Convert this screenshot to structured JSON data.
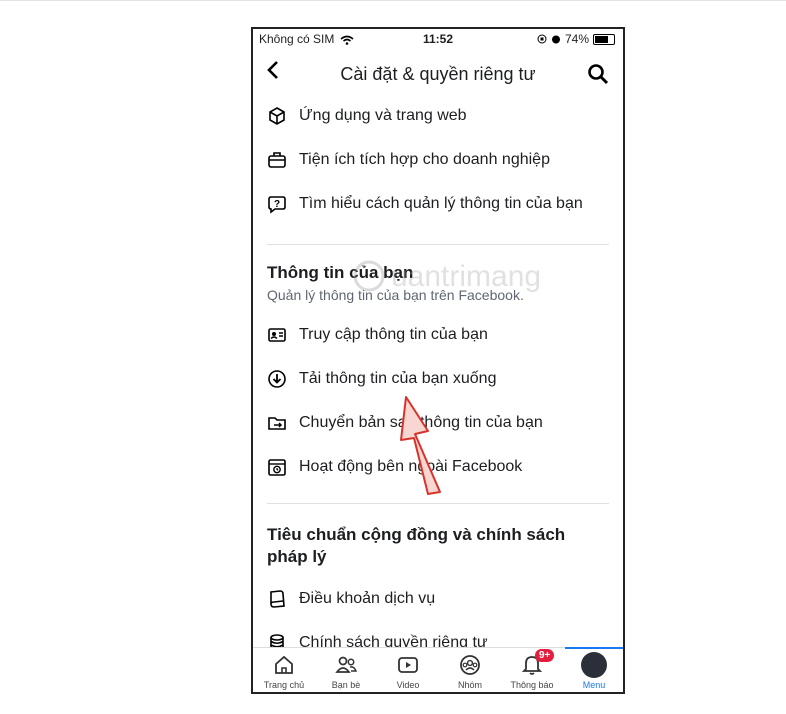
{
  "status": {
    "carrier": "Không có SIM",
    "time": "11:52",
    "battery": "74%"
  },
  "header": {
    "title": "Cài đặt & quyền riêng tư"
  },
  "apps_items": [
    {
      "icon": "cube-icon",
      "label": "Ứng dụng và trang web"
    },
    {
      "icon": "briefcase-icon",
      "label": "Tiện ích tích hợp cho doanh nghiệp"
    },
    {
      "icon": "question-bubble-icon",
      "label": "Tìm hiểu cách quản lý thông tin của bạn"
    }
  ],
  "your_info": {
    "title": "Thông tin của bạn",
    "subtitle": "Quản lý thông tin của bạn trên Facebook.",
    "items": [
      {
        "icon": "id-card-icon",
        "label": "Truy cập thông tin của bạn"
      },
      {
        "icon": "download-icon",
        "label": "Tải thông tin của bạn xuống"
      },
      {
        "icon": "folder-transfer-icon",
        "label": "Chuyển bản sao thông tin của bạn"
      },
      {
        "icon": "activity-icon",
        "label": "Hoạt động bên ngoài Facebook"
      }
    ]
  },
  "community": {
    "title_line1": "Tiêu chuẩn cộng đồng và chính sách",
    "title_line2": "pháp lý",
    "items": [
      {
        "icon": "book-icon",
        "label": "Điều khoản dịch vụ"
      },
      {
        "icon": "database-icon",
        "label": "Chính sách quyền riêng tư"
      }
    ]
  },
  "watermark": "uantrimang",
  "tabs": [
    {
      "label": "Trang chủ",
      "icon": "home-icon"
    },
    {
      "label": "Bạn bè",
      "icon": "friends-icon"
    },
    {
      "label": "Video",
      "icon": "video-icon"
    },
    {
      "label": "Nhóm",
      "icon": "groups-icon"
    },
    {
      "label": "Thông báo",
      "icon": "bell-icon",
      "badge": "9+"
    },
    {
      "label": "Menu",
      "icon": "avatar-icon",
      "active": true
    }
  ],
  "colors": {
    "accent": "#1877f2",
    "badge": "#e41e3f",
    "arrow": "#d9322b"
  }
}
